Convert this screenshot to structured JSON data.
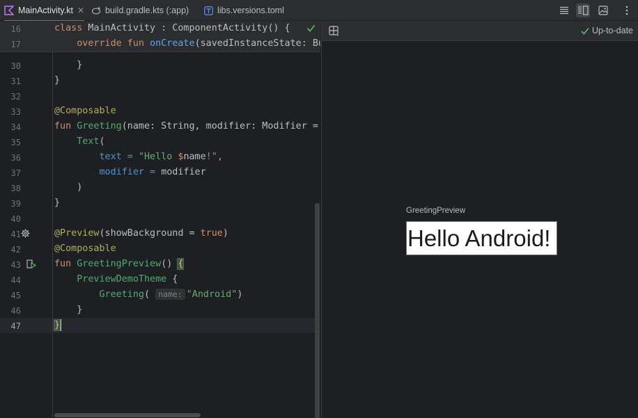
{
  "tabs": [
    {
      "label": "MainActivity.kt",
      "icon": "kotlin-file-icon",
      "active": true,
      "closable": true
    },
    {
      "label": "build.gradle.kts (:app)",
      "icon": "gradle-file-icon",
      "active": false
    },
    {
      "label": "libs.versions.toml",
      "icon": "toml-file-icon",
      "active": false
    }
  ],
  "toolbar": {
    "icons": [
      "code-view-icon",
      "split-view-icon",
      "design-view-icon",
      "more-options-icon"
    ],
    "selected": "split-view-icon"
  },
  "editor": {
    "sticky_lines": [
      {
        "num": "16",
        "text": "class MainActivity : ComponentActivity() {"
      },
      {
        "num": "17",
        "text": "    override fun onCreate(savedInstanceState: Bu"
      }
    ],
    "lines": [
      {
        "num": "30",
        "text": "    }"
      },
      {
        "num": "31",
        "text": "}"
      },
      {
        "num": "32",
        "text": ""
      },
      {
        "num": "33",
        "text": "@Composable"
      },
      {
        "num": "34",
        "text": "fun Greeting(name: String, modifier: Modifier ="
      },
      {
        "num": "35",
        "text": "    Text("
      },
      {
        "num": "36",
        "text": "        text = \"Hello $name!\","
      },
      {
        "num": "37",
        "text": "        modifier = modifier"
      },
      {
        "num": "38",
        "text": "    )"
      },
      {
        "num": "39",
        "text": "}"
      },
      {
        "num": "40",
        "text": ""
      },
      {
        "num": "41",
        "text": "@Preview(showBackground = true)"
      },
      {
        "num": "42",
        "text": "@Composable"
      },
      {
        "num": "43",
        "text": "fun GreetingPreview() {"
      },
      {
        "num": "44",
        "text": "    PreviewDemoTheme {"
      },
      {
        "num": "45",
        "text": "        Greeting( name: \"Android\")"
      },
      {
        "num": "46",
        "text": "    }"
      },
      {
        "num": "47",
        "text": "}"
      }
    ],
    "inlay_hint": "name:",
    "current_line": "47"
  },
  "preview": {
    "status": "Up-to-date",
    "label": "GreetingPreview",
    "rendered_text": "Hello Android!"
  },
  "colors": {
    "accent": "#3574f0",
    "keyword": "#cf8e6d",
    "annotation": "#b3ae60",
    "string": "#6aab73",
    "composable": "#57a873",
    "status_ok": "#5fb865"
  }
}
